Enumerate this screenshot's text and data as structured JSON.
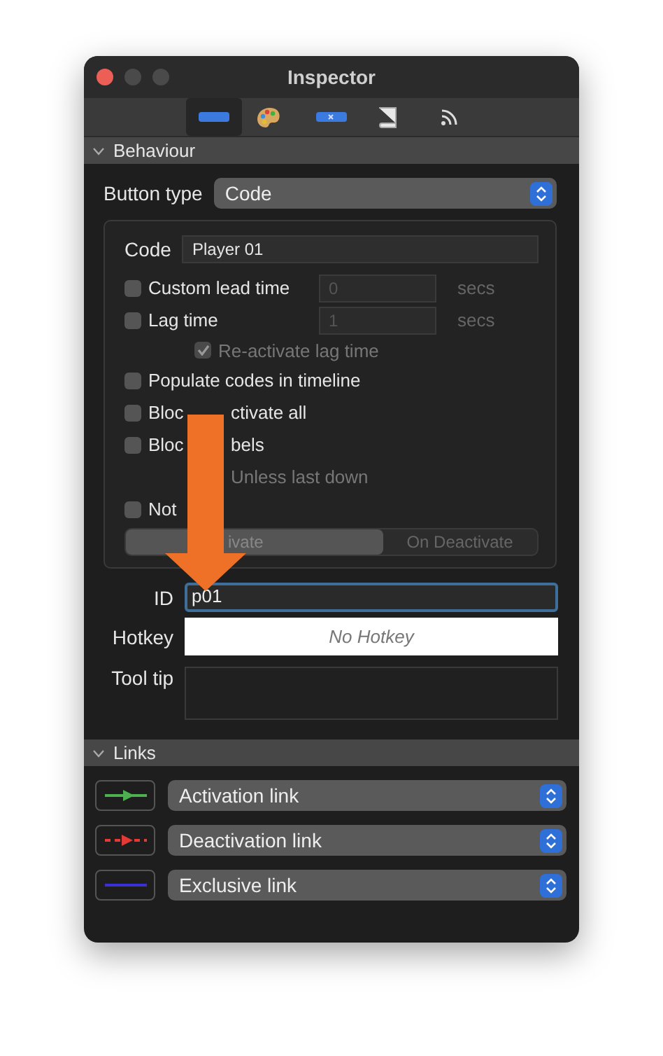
{
  "window": {
    "title": "Inspector"
  },
  "toolbar": [
    {
      "kind": "button",
      "selected": true
    },
    {
      "kind": "palette",
      "selected": false
    },
    {
      "kind": "button-x",
      "selected": false
    },
    {
      "kind": "scroll",
      "selected": false
    },
    {
      "kind": "feed",
      "selected": false
    }
  ],
  "behaviour": {
    "header": "Behaviour",
    "expanded": true,
    "button_type": {
      "label": "Button type",
      "value": "Code"
    },
    "code": {
      "label": "Code",
      "value": "Player 01"
    },
    "options": [
      {
        "kind": "timed",
        "label": "Custom lead time",
        "checked": false,
        "value": "0",
        "unit": "secs"
      },
      {
        "kind": "timed",
        "label": "Lag time",
        "checked": false,
        "value": "1",
        "unit": "secs"
      },
      {
        "kind": "sub",
        "label": "Re-activate lag time",
        "checked": true
      },
      {
        "kind": "check",
        "label": "Populate codes in timeline",
        "checked": false
      },
      {
        "kind": "covered",
        "label": "Bloc",
        "label_after": "ctivate all",
        "checked": false
      },
      {
        "kind": "covered",
        "label": "Bloc",
        "label_after": "bels",
        "checked": false
      },
      {
        "kind": "hidden",
        "label_after": "Unless last down"
      },
      {
        "kind": "check",
        "label": "Not",
        "checked": false
      }
    ],
    "segments": [
      {
        "label": "ivate",
        "selected": true
      },
      {
        "label": "On Deactivate",
        "selected": false
      }
    ],
    "id": {
      "label": "ID",
      "value": "p01"
    },
    "hotkey": {
      "label": "Hotkey",
      "placeholder": "No Hotkey"
    },
    "tooltip": {
      "label": "Tool tip"
    }
  },
  "links": {
    "header": "Links",
    "expanded": true,
    "items": [
      {
        "kind": "arrow",
        "color": "#4caf50",
        "label": "Activation link"
      },
      {
        "kind": "dashed-arrow",
        "color": "#e53935",
        "label": "Deactivation link"
      },
      {
        "kind": "line",
        "color": "#3b2fd6",
        "label": "Exclusive link"
      }
    ]
  }
}
